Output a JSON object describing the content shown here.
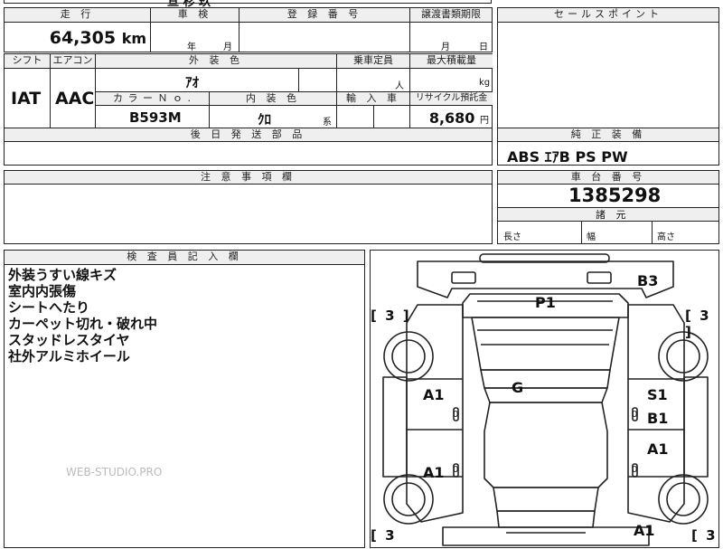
{
  "top_fragment": "亘  杉  玖",
  "mileage": {
    "label": "走 行",
    "value": "64,305",
    "unit": "km"
  },
  "shaken": {
    "label": "車 検",
    "year_unit": "年",
    "month_unit": "月"
  },
  "registration": {
    "label": "登 録 番 号"
  },
  "transfer_deadline": {
    "label": "譲渡書類期限",
    "month_unit": "月",
    "day_unit": "日"
  },
  "shift": {
    "label": "シフト",
    "value": "IAT"
  },
  "aircon": {
    "label": "エアコン",
    "value": "AAC"
  },
  "exterior_color": {
    "label": "外 装 色",
    "value": "ｱｵ"
  },
  "capacity": {
    "label": "乗車定員",
    "unit": "人"
  },
  "max_load": {
    "label": "最大積載量",
    "unit": "kg"
  },
  "color_no": {
    "label": "カ ラ ー Ｎ ｏ .",
    "value": "B593M"
  },
  "interior_color": {
    "label": "内 装 色",
    "value": "ｸﾛ",
    "suffix": "系"
  },
  "import_car": {
    "label": "輸 入 車"
  },
  "recycle": {
    "label": "リサイクル預託金",
    "value": "8,680",
    "unit": "円"
  },
  "later_parts": {
    "label": "後 日 発 送 部 品"
  },
  "sales_point": {
    "label": "セールスポイント"
  },
  "standard_equipment": {
    "label": "純 正 装 備",
    "value": "ABS ｴｱB PS PW"
  },
  "caution": {
    "label": "注 意 事 項 欄"
  },
  "chassis": {
    "label": "車 台 番 号",
    "value": "1385298"
  },
  "dimensions": {
    "label": "諸 元",
    "length": "長さ",
    "width": "幅",
    "height": "高さ"
  },
  "inspector": {
    "label": "検 査 員 記 入 欄",
    "lines": [
      "外装うすい線キズ",
      "室内内張傷",
      "シートへたり",
      "カーペット切れ・破れ中",
      "スタッドレスタイヤ",
      "社外アルミホイール"
    ]
  },
  "watermark": "WEB-STUDIO.PRO",
  "diagram": {
    "marks": {
      "b3": "B3",
      "p1": "P1",
      "g": "G",
      "a1_fl": "A1",
      "a1_rl": "A1",
      "a1_fr": "A1",
      "a1_rr": "A1",
      "s1": "S1",
      "b1": "B1"
    },
    "brackets": {
      "tl": "[ 3 ]",
      "tr": "[ 3 ]",
      "bl": "[ 3",
      "br": "[ 3"
    },
    "zeros": {
      "fl": "0",
      "rl": "0",
      "fr": "0",
      "rr": "0"
    }
  }
}
